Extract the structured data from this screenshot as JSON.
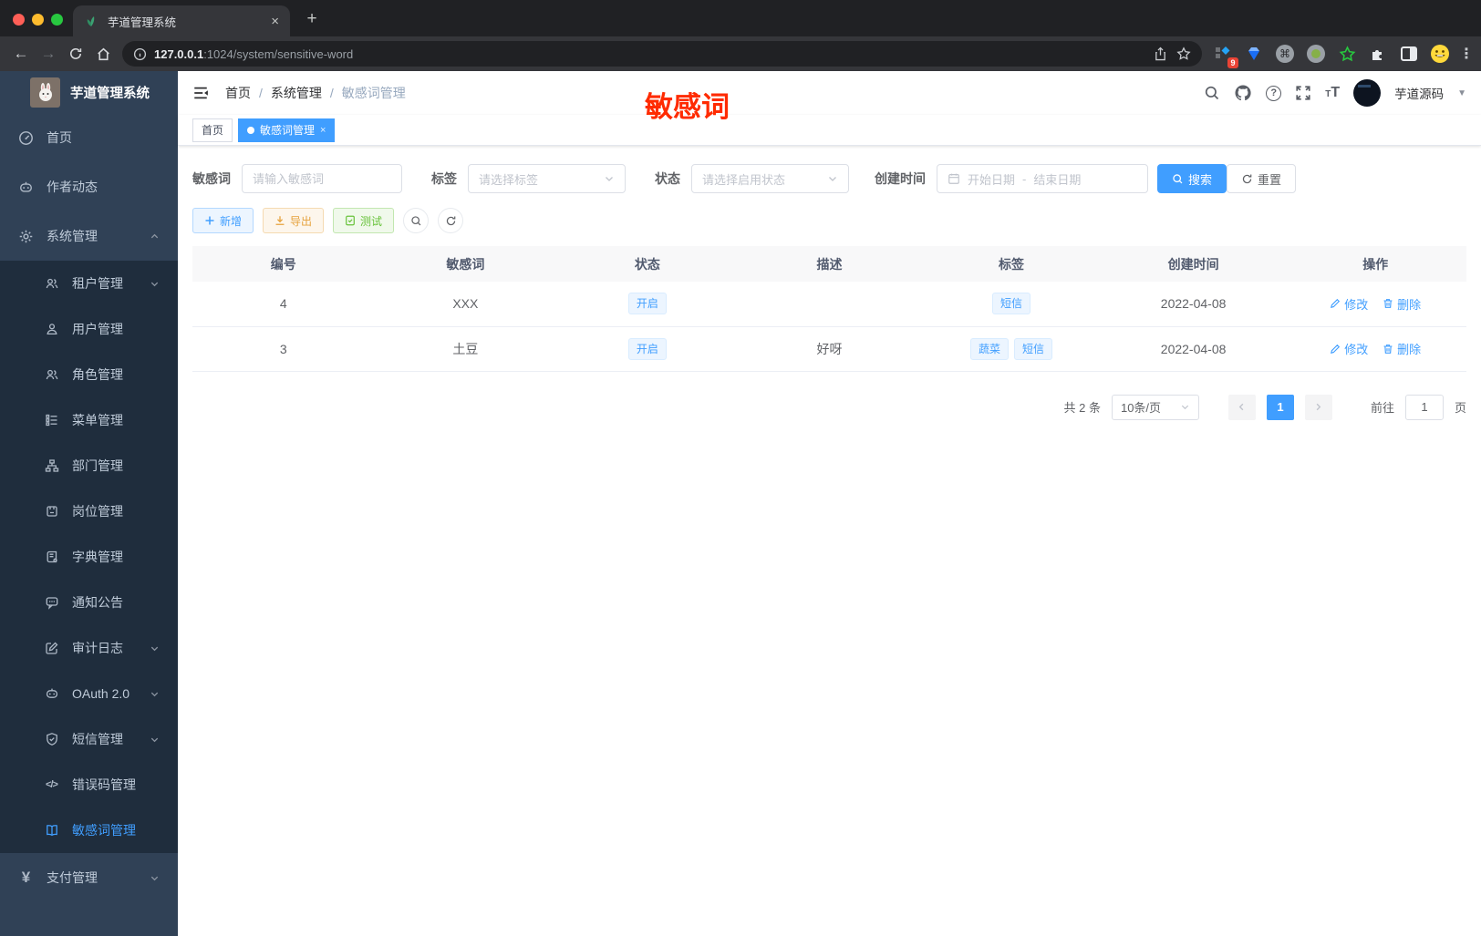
{
  "browser": {
    "tab_title": "芋道管理系统",
    "new_tab": "+",
    "close": "×",
    "url_host": "127.0.0.1",
    "url_rest": ":1024/system/sensitive-word",
    "extension_badge": "9",
    "menu_dots": "⋮"
  },
  "sidebar": {
    "app_title": "芋道管理系统",
    "home": "首页",
    "author": "作者动态",
    "system": "系统管理",
    "children": [
      "租户管理",
      "用户管理",
      "角色管理",
      "菜单管理",
      "部门管理",
      "岗位管理",
      "字典管理",
      "通知公告",
      "审计日志",
      "OAuth 2.0",
      "短信管理",
      "错误码管理",
      "敏感词管理"
    ],
    "payment": "支付管理"
  },
  "header": {
    "breadcrumb": [
      "首页",
      "系统管理",
      "敏感词管理"
    ],
    "separator": "/",
    "username": "芋道源码",
    "annotation": "敏感词"
  },
  "tagsview": {
    "home": "首页",
    "active": "敏感词管理",
    "close": "×"
  },
  "filters": {
    "keyword_label": "敏感词",
    "keyword_placeholder": "请输入敏感词",
    "tag_label": "标签",
    "tag_placeholder": "请选择标签",
    "status_label": "状态",
    "status_placeholder": "请选择启用状态",
    "date_label": "创建时间",
    "date_start_placeholder": "开始日期",
    "date_separator": "-",
    "date_end_placeholder": "结束日期",
    "search_label": "搜索",
    "reset_label": "重置"
  },
  "toolbar": {
    "add_label": "新增",
    "export_label": "导出",
    "test_label": "测试"
  },
  "table": {
    "headers": [
      "编号",
      "敏感词",
      "状态",
      "描述",
      "标签",
      "创建时间",
      "操作"
    ],
    "rows": [
      {
        "id": "4",
        "word": "XXX",
        "status": "开启",
        "description": "",
        "tags": [
          "短信"
        ],
        "created": "2022-04-08"
      },
      {
        "id": "3",
        "word": "土豆",
        "status": "开启",
        "description": "好呀",
        "tags": [
          "蔬菜",
          "短信"
        ],
        "created": "2022-04-08"
      }
    ],
    "ops": {
      "edit": "修改",
      "del": "删除"
    }
  },
  "pagination": {
    "total": "共 2 条",
    "page_size": "10条/页",
    "current": "1",
    "goto_label": "前往",
    "goto_value": "1",
    "page_label": "页"
  },
  "colors": {
    "primary": "#409eff",
    "warning": "#e6a23c",
    "success": "#67c23a",
    "sidebar_bg": "#304156",
    "submenu_bg": "#1f2d3d",
    "annotation_red": "#ff2b00"
  }
}
